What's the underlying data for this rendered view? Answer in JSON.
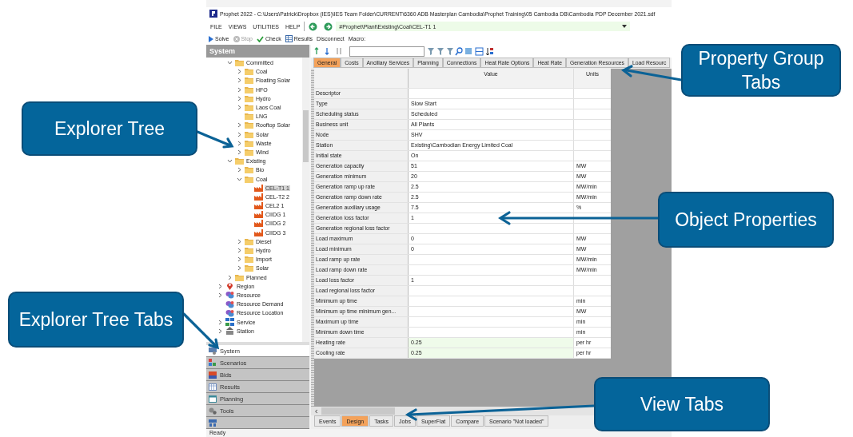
{
  "window": {
    "title": "Prophet 2022 - C:\\Users\\Patrick\\Dropbox (IES)\\IES Team Folder\\CURRENT\\6360 ADB Masterplan Cambodia\\Prophet Training\\05 Cambodia DB\\Cambodia PDP December  2021.sdf"
  },
  "menu": [
    "FILE",
    "VIEWS",
    "UTILITIES",
    "HELP"
  ],
  "address": {
    "value": "#Prophet\\Plant\\Existing\\Coal\\CEL-T1 1"
  },
  "toolbar": [
    {
      "label": "Solve",
      "kind": "play",
      "disabled": false
    },
    {
      "label": "Stop",
      "kind": "stop",
      "disabled": true
    },
    {
      "label": "Check",
      "kind": "tick",
      "disabled": false
    },
    {
      "label": "Results",
      "kind": "grid",
      "disabled": false
    },
    {
      "label": "Disconnect",
      "disabled": false
    },
    {
      "label": "Macro:",
      "disabled": false
    }
  ],
  "explorer": {
    "title": "System",
    "tree": [
      {
        "label": "Committed",
        "kind": "folder",
        "expanded": true,
        "selected": false,
        "children": [
          {
            "label": "Coal",
            "kind": "folder",
            "expanded": false,
            "selected": false
          },
          {
            "label": "Floating Solar",
            "kind": "folder",
            "expanded": false,
            "selected": false
          },
          {
            "label": "HFO",
            "kind": "folder",
            "expanded": false,
            "selected": false
          },
          {
            "label": "Hydro",
            "kind": "folder",
            "expanded": false,
            "selected": false
          },
          {
            "label": "Laos Coal",
            "kind": "folder",
            "expanded": false,
            "selected": false
          },
          {
            "label": "LNG",
            "kind": "folder",
            "selected": false
          },
          {
            "label": "Rooftop Solar",
            "kind": "folder",
            "expanded": false,
            "selected": false
          },
          {
            "label": "Solar",
            "kind": "folder",
            "expanded": false,
            "selected": false
          },
          {
            "label": "Waste",
            "kind": "folder",
            "expanded": false,
            "selected": false
          },
          {
            "label": "Wind",
            "kind": "folder",
            "expanded": false,
            "selected": false
          }
        ]
      },
      {
        "label": "Existing",
        "kind": "folder",
        "expanded": true,
        "selected": false,
        "children": [
          {
            "label": "Bio",
            "kind": "folder",
            "expanded": false,
            "selected": false
          },
          {
            "label": "Coal",
            "kind": "folder",
            "expanded": true,
            "selected": false,
            "children": [
              {
                "label": "CEL-T1 1",
                "kind": "generator",
                "selected": true
              },
              {
                "label": "CEL-T2 2",
                "kind": "generator",
                "selected": false
              },
              {
                "label": "CEL2 1",
                "kind": "generator",
                "selected": false
              },
              {
                "label": "CIIDG 1",
                "kind": "generator",
                "selected": false
              },
              {
                "label": "CIIDG 2",
                "kind": "generator",
                "selected": false
              },
              {
                "label": "CIIDG 3",
                "kind": "generator",
                "selected": false
              }
            ]
          },
          {
            "label": "Diesel",
            "kind": "folder",
            "expanded": false,
            "selected": false
          },
          {
            "label": "Hydro",
            "kind": "folder",
            "expanded": false,
            "selected": false
          },
          {
            "label": "Import",
            "kind": "folder",
            "expanded": false,
            "selected": false
          },
          {
            "label": "Solar",
            "kind": "folder",
            "expanded": false,
            "selected": false
          }
        ]
      },
      {
        "label": "Planned",
        "kind": "folder",
        "expanded": false,
        "selected": false
      }
    ],
    "classes": [
      {
        "label": "Region",
        "kind": "pin",
        "expanded": false,
        "selected": false
      },
      {
        "label": "Resource",
        "kind": "resource",
        "expanded": false,
        "selected": false
      },
      {
        "label": "Resource Demand",
        "kind": "resource",
        "selected": false
      },
      {
        "label": "Resource Location",
        "kind": "resource",
        "selected": false
      },
      {
        "label": "Service",
        "kind": "service",
        "expanded": false,
        "selected": false
      },
      {
        "label": "Station",
        "kind": "station",
        "expanded": false,
        "selected": false
      }
    ],
    "tabs": [
      {
        "label": "System",
        "kind": "system",
        "selected": true
      },
      {
        "label": "Scenarios",
        "kind": "scenarios",
        "selected": false
      },
      {
        "label": "Bids",
        "kind": "bids",
        "selected": false
      },
      {
        "label": "Results",
        "kind": "results",
        "selected": false
      },
      {
        "label": "Planning",
        "kind": "planning",
        "selected": false
      },
      {
        "label": "Tools",
        "kind": "tools",
        "selected": false
      },
      {
        "kind": "extra",
        "selected": false
      }
    ]
  },
  "property_tabs": [
    {
      "label": "General",
      "selected": true
    },
    {
      "label": "Costs",
      "selected": false
    },
    {
      "label": "Ancillary Services",
      "selected": false
    },
    {
      "label": "Planning",
      "selected": false
    },
    {
      "label": "Connections",
      "selected": false
    },
    {
      "label": "Heat Rate Options",
      "selected": false
    },
    {
      "label": "Heat Rate",
      "selected": false
    },
    {
      "label": "Generation Resources",
      "selected": false
    },
    {
      "label": "Load Resourc",
      "selected": false
    }
  ],
  "grid": {
    "columns": [
      "Value",
      "Units"
    ],
    "rows": [
      {
        "name": "Descriptor",
        "highlighted": false
      },
      {
        "name": "Type",
        "value": "Slow Start",
        "highlighted": false
      },
      {
        "name": "Scheduling status",
        "value": "Scheduled",
        "highlighted": false
      },
      {
        "name": "Business unit",
        "value": "All Plants",
        "highlighted": false
      },
      {
        "name": "Node",
        "value": "SHV",
        "highlighted": false
      },
      {
        "name": "Station",
        "value": "Existing\\Cambodian Energy Limited Coal",
        "highlighted": false
      },
      {
        "name": "Initial state",
        "value": "On",
        "highlighted": false
      },
      {
        "name": "Generation capacity",
        "value": "51",
        "units": "MW",
        "highlighted": false
      },
      {
        "name": "Generation minimum",
        "value": "20",
        "units": "MW",
        "highlighted": false
      },
      {
        "name": "Generation ramp up rate",
        "value": "2.5",
        "units": "MW/min",
        "highlighted": false
      },
      {
        "name": "Generation ramp down rate",
        "value": "2.5",
        "units": "MW/min",
        "highlighted": false
      },
      {
        "name": "Generation auxiliary usage",
        "value": "7.5",
        "units": "%",
        "highlighted": false
      },
      {
        "name": "Generation loss factor",
        "value": "1",
        "highlighted": false
      },
      {
        "name": "Generation regional loss factor",
        "highlighted": false
      },
      {
        "name": "Load maximum",
        "value": "0",
        "units": "MW",
        "highlighted": false
      },
      {
        "name": "Load minimum",
        "value": "0",
        "units": "MW",
        "highlighted": false
      },
      {
        "name": "Load ramp up rate",
        "units": "MW/min",
        "highlighted": false
      },
      {
        "name": "Load ramp down rate",
        "units": "MW/min",
        "highlighted": false
      },
      {
        "name": "Load loss factor",
        "value": "1",
        "highlighted": false
      },
      {
        "name": "Load regional loss factor",
        "highlighted": false
      },
      {
        "name": "Minimum up time",
        "units": "min",
        "highlighted": false
      },
      {
        "name": "Minimum up time minimum gen...",
        "units": "MW",
        "highlighted": false
      },
      {
        "name": "Maximum up time",
        "units": "min",
        "highlighted": false
      },
      {
        "name": "Minimum down time",
        "units": "min",
        "highlighted": false
      },
      {
        "name": "Heating rate",
        "value": "0.25",
        "units": "per hr",
        "highlighted": true
      },
      {
        "name": "Cooling rate",
        "value": "0.25",
        "units": "per hr",
        "highlighted": true
      }
    ]
  },
  "view_tabs": [
    {
      "label": "Events",
      "selected": false
    },
    {
      "label": "Design",
      "selected": true
    },
    {
      "label": "Tasks",
      "selected": false
    },
    {
      "label": "Jobs",
      "selected": false
    },
    {
      "label": "SuperFlat",
      "selected": false
    },
    {
      "label": "Compare",
      "selected": false
    },
    {
      "label": "Scenario \"Not loaded\"",
      "selected": false
    }
  ],
  "status_bar": "Ready",
  "callouts": [
    {
      "text": "Property Group Tabs",
      "kind": "property-tabs"
    },
    {
      "text": "Explorer Tree",
      "kind": "tree"
    },
    {
      "text": "Object Properties",
      "kind": "properties"
    },
    {
      "text": "Explorer Tree Tabs",
      "kind": "tree-tabs"
    },
    {
      "text": "View Tabs",
      "kind": "view-tabs"
    }
  ]
}
